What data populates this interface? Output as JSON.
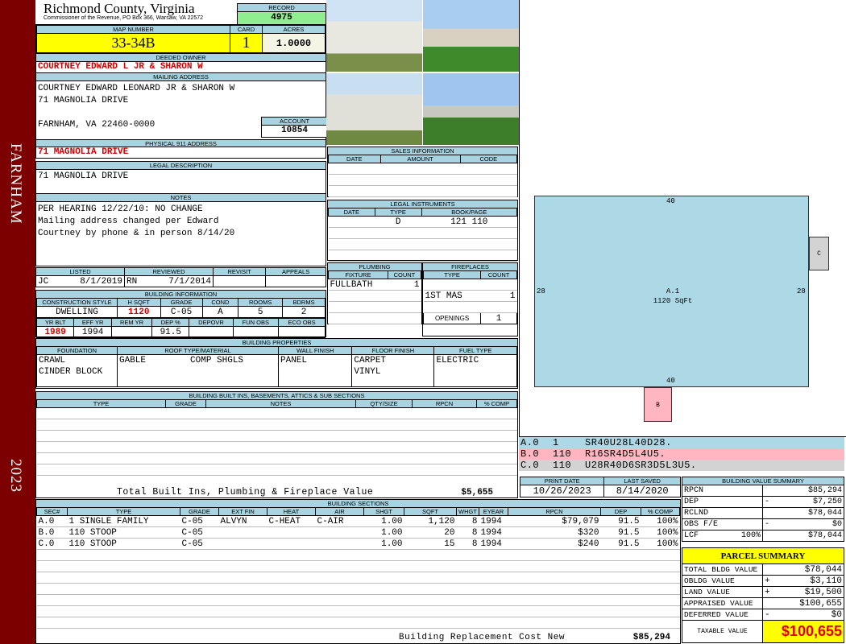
{
  "sidebar": {
    "district": "FARNHAM",
    "year": "2023"
  },
  "header": {
    "county": "Richmond County, Virginia",
    "subtitle": "Commissioner of the Revenue, PO Box 366, Warsaw, VA 22572",
    "record_label": "RECORD",
    "record": "4975",
    "map_label": "MAP NUMBER",
    "map": "33-34B",
    "card_label": "CARD",
    "card": "1",
    "acres_label": "ACRES",
    "acres": "1.0000"
  },
  "owner": {
    "deeded_label": "DEEDED OWNER",
    "deeded": "COURTNEY EDWARD L JR & SHARON W",
    "mailing_label": "MAILING ADDRESS",
    "mail1": "COURTNEY EDWARD LEONARD JR & SHARON W",
    "mail2": "71 MAGNOLIA DRIVE",
    "mail3": "FARNHAM, VA 22460-0000",
    "account_label": "ACCOUNT",
    "account": "10854",
    "physical_label": "PHYSICAL 911 ADDRESS",
    "physical": "71 MAGNOLIA DRIVE",
    "legal_label": "LEGAL DESCRIPTION",
    "legal": "71 MAGNOLIA DRIVE",
    "notes_label": "NOTES",
    "notes": [
      "PER HEARING 12/22/10: NO CHANGE",
      "Mailing address changed per Edward",
      "Courtney by phone & in person 8/14/20"
    ]
  },
  "listing": {
    "labels": [
      "LISTED",
      "REVIEWED",
      "REVISIT",
      "APPEALS"
    ],
    "listed_by": "JC",
    "listed": "8/1/2019",
    "reviewed_by": "RN",
    "reviewed": "7/1/2014"
  },
  "building_info": {
    "title": "BUILDING INFORMATION",
    "labels1": [
      "CONSTRUCTION STYLE",
      "H SQFT",
      "GRADE",
      "COND",
      "ROOMS",
      "BDRMS"
    ],
    "values1": [
      "DWELLING",
      "1120",
      "C-05",
      "A",
      "5",
      "2"
    ],
    "labels2": [
      "YR BLT",
      "EFF YR",
      "REM YR",
      "DEP %",
      "DEPOVR",
      "FUN OBS",
      "ECO OBS"
    ],
    "values2": [
      "1989",
      "1994",
      "",
      "91.5",
      "",
      "",
      ""
    ]
  },
  "sales": {
    "title": "SALES INFORMATION",
    "cols": [
      "DATE",
      "AMOUNT",
      "CODE"
    ]
  },
  "legal_instruments": {
    "title": "LEGAL INSTRUMENTS",
    "cols": [
      "DATE",
      "TYPE",
      "BOOK/PAGE"
    ],
    "row": [
      "",
      "D",
      "121 110"
    ]
  },
  "plumbing": {
    "title": "PLUMBING",
    "cols": [
      "FIXTURE",
      "COUNT"
    ],
    "fixture": "FULLBATH",
    "count": "1"
  },
  "fireplaces": {
    "title": "FIREPLACES",
    "cols": [
      "TYPE",
      "COUNT"
    ],
    "type": "1ST MAS",
    "count": "1",
    "openings_label": "OPENINGS",
    "openings": "1"
  },
  "properties": {
    "title": "BUILDING PROPERTIES",
    "cols": [
      "FOUNDATION",
      "ROOF TYPE/MATERIAL",
      "WALL FINISH",
      "FLOOR FINISH",
      "FUEL TYPE"
    ],
    "foundation": [
      "CRAWL",
      "CINDER BLOCK"
    ],
    "roof_type": "GABLE",
    "roof_material": "COMP SHGLS",
    "wall": "PANEL",
    "floor": [
      "CARPET",
      "VINYL"
    ],
    "fuel": "ELECTRIC"
  },
  "builtins": {
    "title": "BUILDING BUILT INS, BASEMENTS, ATTICS & SUB SECTIONS",
    "cols": [
      "TYPE",
      "GRADE",
      "NOTES",
      "QTY/SIZE",
      "RPCN",
      "% COMP"
    ],
    "total_label": "Total Built Ins, Plumbing & Fireplace Value",
    "total": "$5,655"
  },
  "sections": {
    "title": "BUILDING SECTIONS",
    "cols": [
      "SEC#",
      "TYPE",
      "GRADE",
      "EXT FIN",
      "HEAT",
      "AIR",
      "SHGT",
      "SQFT",
      "WHGT",
      "EYEAR",
      "RPCN",
      "DEP",
      "% COMP"
    ],
    "rows": [
      [
        "A.0",
        "1 SINGLE FAMILY",
        "C-05",
        "ALVYN",
        "C-HEAT",
        "C-AIR",
        "1.00",
        "1,120",
        "8",
        "1994",
        "$79,079",
        "91.5",
        "100%"
      ],
      [
        "B.0",
        "110 STOOP",
        "C-05",
        "",
        "",
        "",
        "1.00",
        "20",
        "8",
        "1994",
        "$320",
        "91.5",
        "100%"
      ],
      [
        "C.0",
        "110 STOOP",
        "C-05",
        "",
        "",
        "",
        "1.00",
        "15",
        "8",
        "1994",
        "$240",
        "91.5",
        "100%"
      ]
    ],
    "total_label": "Building Replacement Cost New",
    "total": "$85,294"
  },
  "sketch": {
    "top": "40",
    "bottom": "40",
    "left": "28",
    "right": "28",
    "area_label": "A.1",
    "area": "1120 SqFt",
    "b": "B",
    "c": "C",
    "codes": [
      [
        "A.0",
        "1",
        "SR40U28L40D28."
      ],
      [
        "B.0",
        "110",
        "R16SR4D5L4U5."
      ],
      [
        "C.0",
        "110",
        "U28R40D6SR3D5L3U5."
      ]
    ]
  },
  "dates": {
    "print_label": "PRINT DATE",
    "print": "10/26/2023",
    "saved_label": "LAST SAVED",
    "saved": "8/14/2020"
  },
  "value_summary": {
    "title": "BUILDING VALUE SUMMARY",
    "rows": [
      [
        "RPCN",
        "",
        "",
        "$85,294"
      ],
      [
        "DEP",
        "",
        "-",
        "$7,250"
      ],
      [
        "RCLND",
        "",
        "",
        "$78,044"
      ],
      [
        "OBS F/E",
        "",
        "-",
        "$0"
      ],
      [
        "LCF",
        "100%",
        "",
        "$78,044"
      ]
    ]
  },
  "parcel": {
    "title": "PARCEL SUMMARY",
    "rows": [
      [
        "TOTAL BLDG VALUE",
        "",
        "$78,044"
      ],
      [
        "OBLDG VALUE",
        "+",
        "$3,110"
      ],
      [
        "LAND VALUE",
        "+",
        "$19,500"
      ],
      [
        "APPRAISED VALUE",
        "",
        "$100,655"
      ],
      [
        "DEFERRED VALUE",
        "-",
        "$0"
      ]
    ],
    "taxable_label": "TAXABLE VALUE",
    "taxable": "$100,655"
  }
}
